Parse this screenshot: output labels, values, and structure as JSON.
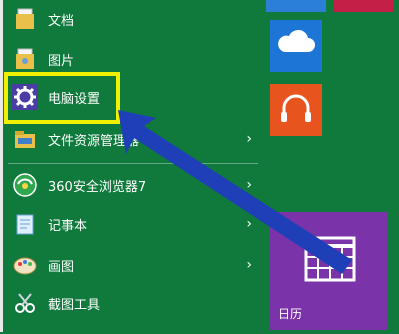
{
  "start_menu": {
    "items": [
      {
        "label": "文档",
        "icon": "document-folder-icon"
      },
      {
        "label": "图片",
        "icon": "pictures-folder-icon"
      },
      {
        "label": "电脑设置",
        "icon": "gear-icon"
      },
      {
        "label": "文件资源管理器",
        "icon": "file-explorer-icon"
      },
      {
        "label": "360安全浏览器7",
        "icon": "browser-360-icon"
      },
      {
        "label": "记事本",
        "icon": "notepad-icon"
      },
      {
        "label": "画图",
        "icon": "paint-palette-icon"
      },
      {
        "label": "截图工具",
        "icon": "snipping-tool-icon"
      }
    ],
    "chevron": "›"
  },
  "tiles": {
    "calendar_label": "日历",
    "onedrive_icon": "cloud-icon",
    "music_icon": "headphones-icon",
    "calendar_icon": "calendar-grid-icon"
  },
  "colors": {
    "menu_bg": "#0f7a3c",
    "highlight": "#f1f000",
    "arrow": "#1f3fb8",
    "tile_blue": "#1d76d6",
    "tile_orange": "#e7541e",
    "tile_purple": "#7a33a8"
  }
}
